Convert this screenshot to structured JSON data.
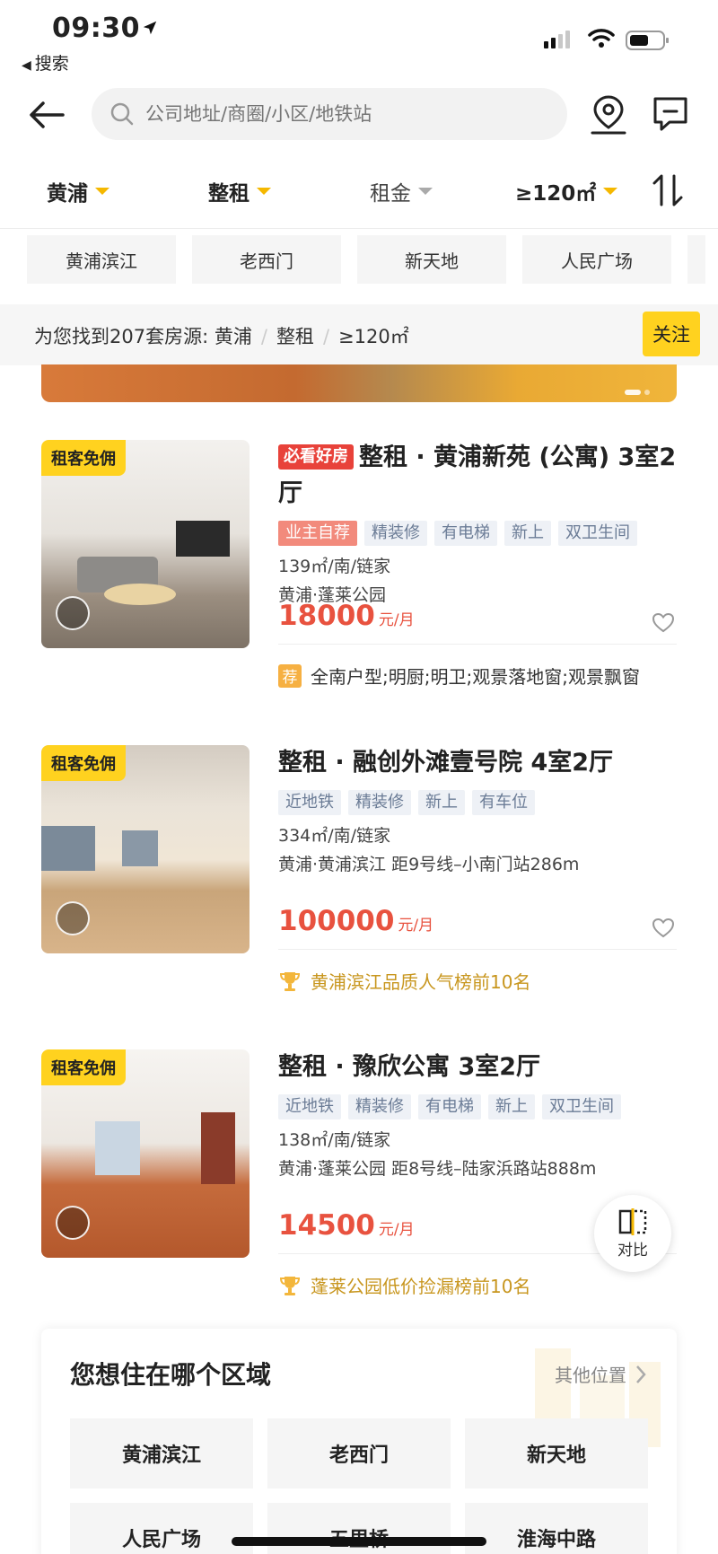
{
  "status_bar": {
    "time": "09:30",
    "back_app": "搜索"
  },
  "search": {
    "placeholder": "公司地址/商圈/小区/地铁站"
  },
  "filters": [
    {
      "label": "黄浦",
      "active": true
    },
    {
      "label": "整租",
      "active": true
    },
    {
      "label": "租金",
      "active": false
    },
    {
      "label": "≥120㎡",
      "active": true
    }
  ],
  "quick_tags": [
    "黄浦滨江",
    "老西门",
    "新天地",
    "人民广场"
  ],
  "results": {
    "summary": "为您找到207套房源:",
    "criteria": [
      "黄浦",
      "整租",
      "≥120㎡"
    ],
    "follow_label": "关注"
  },
  "listings": [
    {
      "badge": "租客免佣",
      "must_see": "必看好房",
      "title": "整租 · 黄浦新苑 (公寓) 3室2厅",
      "tags": [
        {
          "text": "业主自荐",
          "hot": true
        },
        {
          "text": "精装修",
          "hot": false
        },
        {
          "text": "有电梯",
          "hot": false
        },
        {
          "text": "新上",
          "hot": false
        },
        {
          "text": "双卫生间",
          "hot": false
        }
      ],
      "spec": "139㎡/南/链家",
      "location": "黄浦·蓬莱公园",
      "price": "18000",
      "unit": "元/月",
      "note_type": "rec",
      "note_icon_text": "荐",
      "note": "全南户型;明厨;明卫;观景落地窗;观景飘窗"
    },
    {
      "badge": "租客免佣",
      "must_see": "",
      "title": "整租 · 融创外滩壹号院 4室2厅",
      "tags": [
        {
          "text": "近地铁",
          "hot": false
        },
        {
          "text": "精装修",
          "hot": false
        },
        {
          "text": "新上",
          "hot": false
        },
        {
          "text": "有车位",
          "hot": false
        }
      ],
      "spec": "334㎡/南/链家",
      "location": "黄浦·黄浦滨江 距9号线–小南门站286m",
      "price": "100000",
      "unit": "元/月",
      "note_type": "trophy",
      "note": "黄浦滨江品质人气榜前10名"
    },
    {
      "badge": "租客免佣",
      "must_see": "",
      "title": "整租 · 豫欣公寓 3室2厅",
      "tags": [
        {
          "text": "近地铁",
          "hot": false
        },
        {
          "text": "精装修",
          "hot": false
        },
        {
          "text": "有电梯",
          "hot": false
        },
        {
          "text": "新上",
          "hot": false
        },
        {
          "text": "双卫生间",
          "hot": false
        }
      ],
      "spec": "138㎡/南/链家",
      "location": "黄浦·蓬莱公园 距8号线–陆家浜路站888m",
      "price": "14500",
      "unit": "元/月",
      "note_type": "trophy",
      "note": "蓬莱公园低价捡漏榜前10名"
    }
  ],
  "compare": {
    "label": "对比"
  },
  "area_section": {
    "title": "您想住在哪个区域",
    "other": "其他位置",
    "areas": [
      "黄浦滨江",
      "老西门",
      "新天地",
      "人民广场",
      "五里桥",
      "淮海中路"
    ]
  },
  "colors": {
    "accent": "#ffd21f",
    "price": "#e8523f",
    "must_see": "#e8423a",
    "tag_text": "#6b7c96"
  },
  "icons": [
    "location-arrow-icon",
    "signal-icon",
    "wifi-icon",
    "battery-icon",
    "back-arrow-icon",
    "search-icon",
    "map-pin-icon",
    "message-icon",
    "sort-icon",
    "vr-icon",
    "heart-icon",
    "trophy-icon",
    "compare-icon",
    "chevron-right-icon"
  ]
}
